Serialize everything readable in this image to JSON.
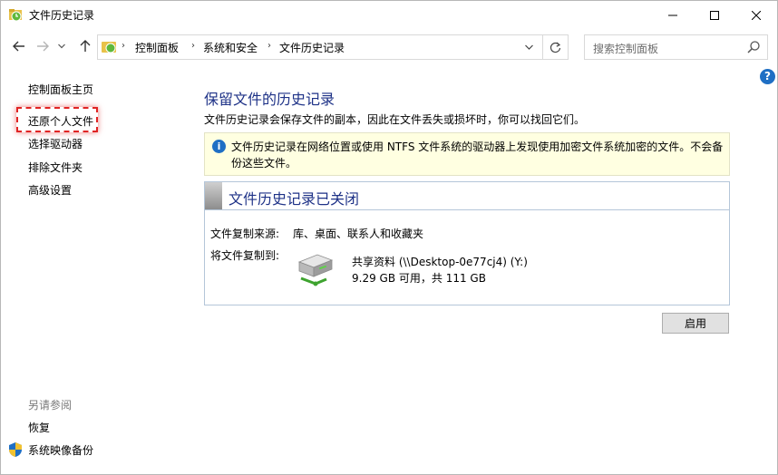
{
  "window": {
    "title": "文件历史记录"
  },
  "address": {
    "breadcrumbs": [
      "控制面板",
      "系统和安全",
      "文件历史记录"
    ],
    "search_placeholder": "搜索控制面板"
  },
  "sidebar": {
    "links": [
      "控制面板主页",
      "还原个人文件",
      "选择驱动器",
      "排除文件夹",
      "高级设置"
    ],
    "see_also_title": "另请参阅",
    "see_also": [
      "恢复",
      "系统映像备份"
    ]
  },
  "main": {
    "title": "保留文件的历史记录",
    "description": "文件历史记录会保存文件的副本，因此在文件丢失或损坏时，你可以找回它们。",
    "info": "文件历史记录在网络位置或使用 NTFS 文件系统的驱动器上发现使用加密文件系统加密的文件。不会备份这些文件。",
    "status_title": "文件历史记录已关闭",
    "copy_from_label": "文件复制来源:",
    "copy_from_value": "库、桌面、联系人和收藏夹",
    "copy_to_label": "将文件复制到:",
    "drive_name": "共享资料 (\\\\Desktop-0e77cj4) (Y:)",
    "drive_space": "9.29 GB 可用，共 111 GB",
    "enable_button": "启用"
  },
  "icons": {
    "help": "?",
    "info": "i"
  },
  "colors": {
    "heading": "#1e3287",
    "info_bg": "#ffffe1",
    "highlight": "#e02424"
  }
}
